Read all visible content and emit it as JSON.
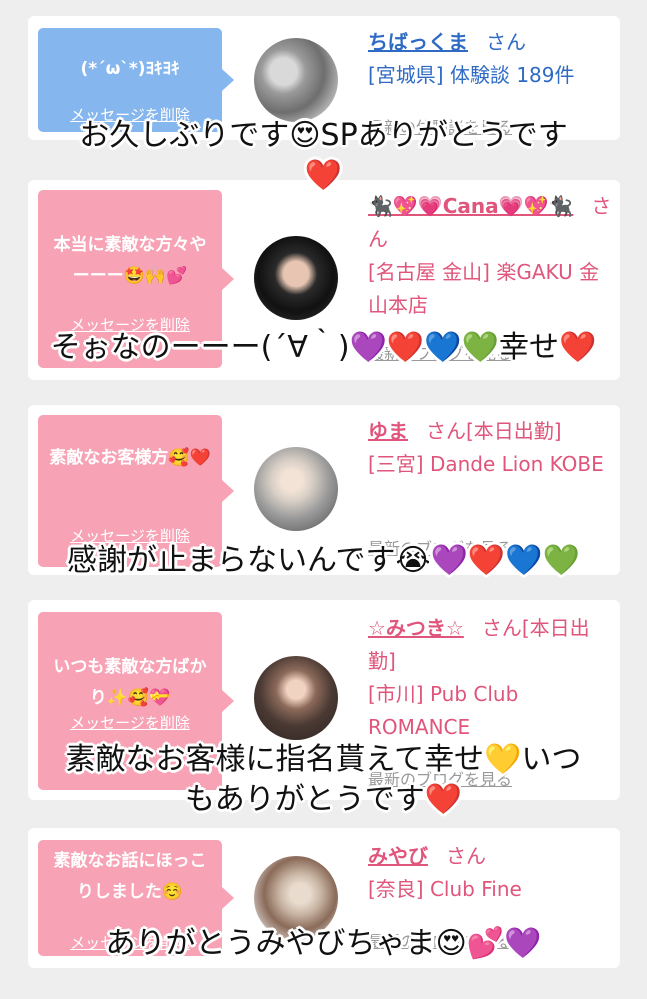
{
  "cards": [
    {
      "message": "(*´ω`*)ﾖｷﾖｷ",
      "delete_label": "メッセージを削除",
      "name": "ちばっくま",
      "honorific": "さん",
      "detail": "[宮城県] 体験談 189件",
      "latest_label": "最新の体験談を見る"
    },
    {
      "message": "本当に素敵な方々やーーー🤩🙌💕",
      "delete_label": "メッセージを削除",
      "name": "🐈‍⬛💖💗Cana💗💖🐈‍⬛",
      "honorific": "さん",
      "detail": "[名古屋 金山] 楽GAKU 金山本店",
      "latest_label": "最新のブログを見る"
    },
    {
      "message": "素敵なお客様方🥰❤️",
      "delete_label": "メッセージを削除",
      "name": "ゆま",
      "honorific": "さん[本日出勤]",
      "detail": "[三宮] Dande Lion KOBE",
      "latest_label": "最新のブログを見る"
    },
    {
      "message": "いつも素敵な方ばかり✨🥰💝",
      "delete_label": "メッセージを削除",
      "name": "☆みつき☆",
      "honorific": "さん[本日出勤]",
      "detail": "[市川] Pub Club ROMANCE",
      "latest_label": "最新のブログを見る"
    },
    {
      "message": "素敵なお話にほっこりしました☺️",
      "delete_label": "メッセージを削除",
      "name": "みやび",
      "honorific": "さん",
      "detail": "[奈良] Club Fine",
      "latest_label": "最新のブログを見る"
    }
  ],
  "captions": [
    "お久しぶりです😍SPありがとうです\n❤️",
    "そぉなのーーー(´∀｀)💜❤️💙💚幸せ❤️",
    "感謝が止まらないんです😭💜❤️💙💚",
    "素敵なお客様に指名貰えて幸せ💛いつ\nもありがとうです❤️",
    "ありがとうみやびちゃま😍💕💜"
  ],
  "colors": {
    "bubble_blue": "#86b6ee",
    "bubble_pink": "#f7a3b5",
    "name_blue": "#2f6bc4",
    "name_pink": "#e0557b"
  },
  "icons": [
    "avatar-photo-car",
    "avatar-photo-woman",
    "avatar-photo-blonde",
    "avatar-photo-glass",
    "avatar-photo-hair"
  ]
}
